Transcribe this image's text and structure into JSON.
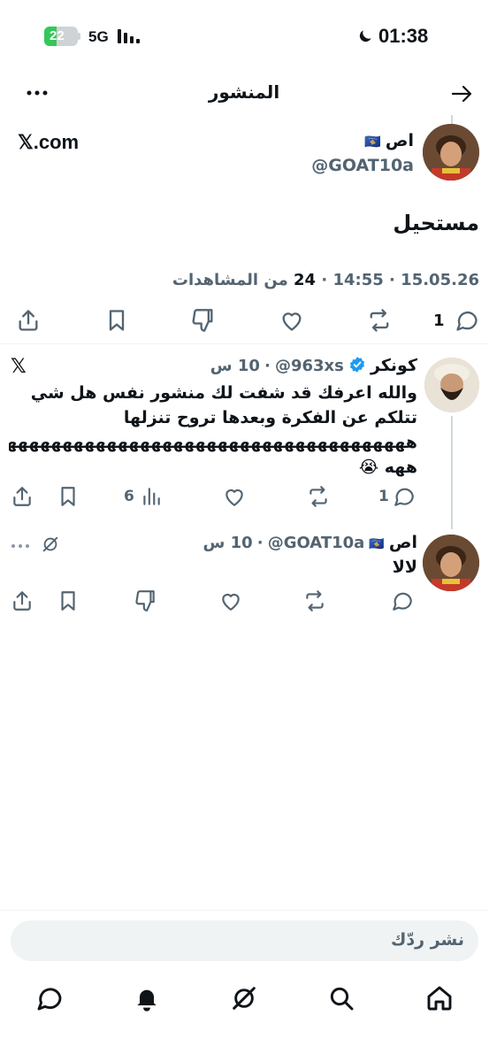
{
  "status_bar": {
    "time": "01:38",
    "network": "5G",
    "battery": "22"
  },
  "header": {
    "title": "المنشور"
  },
  "main_post": {
    "author_name": "اص",
    "flag": "🇽🇰",
    "handle": "@GOAT10a",
    "source": "𝕏.com",
    "text": "مستحيل",
    "date": "15.05.26",
    "time": "14:55",
    "views_count": "24",
    "views_label": "من المشاهدات",
    "reply_count": "1"
  },
  "replies": [
    {
      "author_name": "كونكر",
      "handle": "@963xs",
      "age": "10 س",
      "line1": "والله اعرفك قد شفت لك منشور نفس هل شي",
      "line2": "تتلكم عن الفكرة وبعدها تروح تنزلها",
      "line3": "هههههههههههههههههههههههههههههههههههههههه",
      "line4": "ههه",
      "emoji": "😭",
      "reply_count": "1",
      "views_count": "6"
    },
    {
      "author_name": "اص",
      "flag": "🇽🇰",
      "handle": "@GOAT10a",
      "age": "10 س",
      "text": "لالا"
    }
  ],
  "composer": {
    "placeholder": "نشر ردّك"
  },
  "colors": {
    "verified": "#1d9bf0",
    "text": "#0f1419",
    "secondary": "#536471",
    "input_bg": "#eff3f4"
  }
}
